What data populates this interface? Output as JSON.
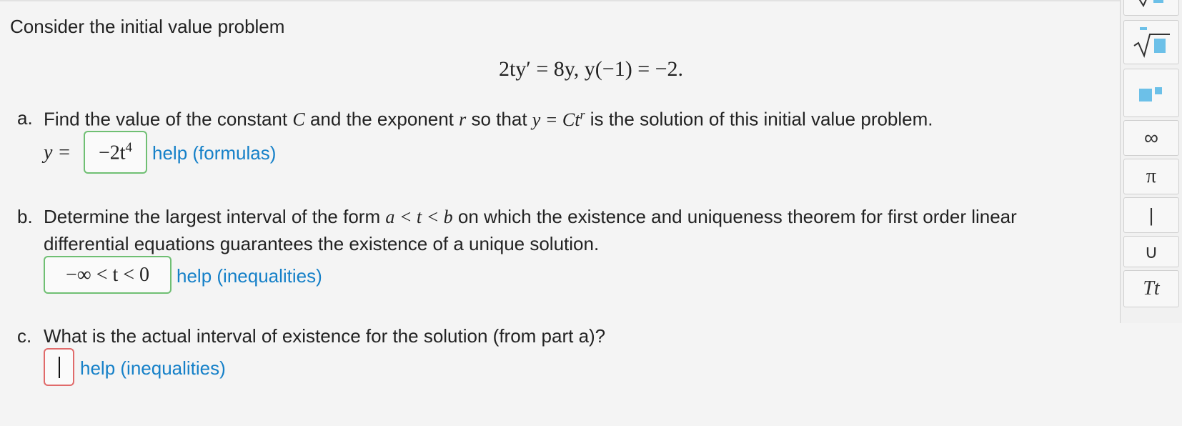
{
  "problem": {
    "intro": "Consider the initial value problem",
    "equation": "2ty′ = 8y,   y(−1) = −2."
  },
  "part_a": {
    "label": "a.",
    "text_1": "Find the value of the constant",
    "var_C": "C",
    "text_2": "and the exponent",
    "var_r": "r",
    "text_3": "so that",
    "formula": "y = Ct",
    "formula_exp": "r",
    "text_4": "is the solution of this initial value problem.",
    "answer_prefix": "y =",
    "answer_value": "−2t",
    "answer_exp": "4",
    "help": "help (formulas)"
  },
  "part_b": {
    "label": "b.",
    "text_1": "Determine the largest interval of the form",
    "interval_form": "a < t < b",
    "text_2": "on which the existence and uniqueness theorem for first order linear",
    "text_3": "differential equations guarantees the existence of a unique solution.",
    "answer_value": "−∞ < t < 0",
    "help": "help (inequalities)"
  },
  "part_c": {
    "label": "c.",
    "text": "What is the actual interval of existence for the solution (from part a)?",
    "answer_value": "",
    "help": "help (inequalities)"
  },
  "palette": {
    "buttons": [
      "sqrt-template",
      "sqrt",
      "subscript",
      "∞",
      "π",
      "|",
      "∪",
      "Tt"
    ]
  },
  "colors": {
    "link": "#1580c8",
    "correct_border": "#6fbf73",
    "empty_border": "#e06a6a",
    "palette_square": "#6cc0e8"
  }
}
